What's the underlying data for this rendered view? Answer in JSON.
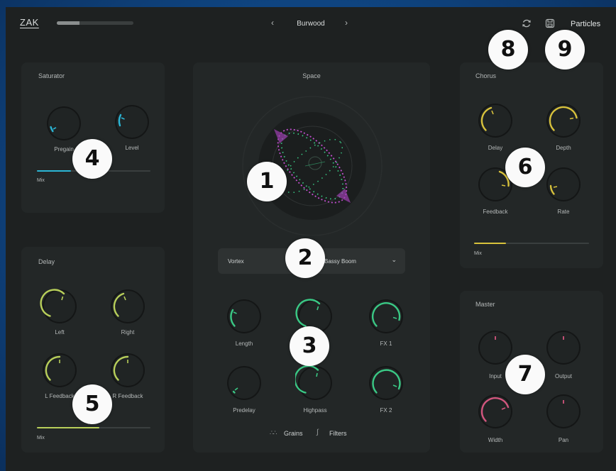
{
  "app": {
    "logo": "ZAK",
    "progress_fraction": 0.3
  },
  "preset": {
    "name": "Burwood",
    "prev_label": "‹",
    "next_label": "›"
  },
  "brand": "Particles",
  "saturator": {
    "title": "Saturator",
    "pregain_label": "Pregain",
    "level_label": "Level",
    "mix_label": "Mix",
    "mix_value": 0.3,
    "accent": "#2bb6d6"
  },
  "space": {
    "title": "Space",
    "mode_left": "Vortex",
    "mode_right": "Bassy Boom",
    "knobs": [
      "Length",
      "FX 1",
      "Predelay",
      "Highpass",
      "FX 2"
    ],
    "tabs": {
      "grains": "Grains",
      "filters": "Filters"
    },
    "accent": "#3ac985"
  },
  "delay": {
    "title": "Delay",
    "left_label": "Left",
    "right_label": "Right",
    "lfeedback_label": "L Feedback",
    "rfeedback_label": "R Feedback",
    "mix_label": "Mix",
    "mix_value": 0.55,
    "accent": "#b8cf5a"
  },
  "chorus": {
    "title": "Chorus",
    "delay_label": "Delay",
    "depth_label": "Depth",
    "feedback_label": "Feedback",
    "rate_label": "Rate",
    "mix_label": "Mix",
    "mix_value": 0.25,
    "accent": "#d8c23c"
  },
  "master": {
    "title": "Master",
    "input_label": "Input",
    "output_label": "Output",
    "width_label": "Width",
    "pan_label": "Pan",
    "accent": "#d2567e"
  },
  "badges": [
    "1",
    "2",
    "3",
    "4",
    "5",
    "6",
    "7",
    "8",
    "9"
  ]
}
